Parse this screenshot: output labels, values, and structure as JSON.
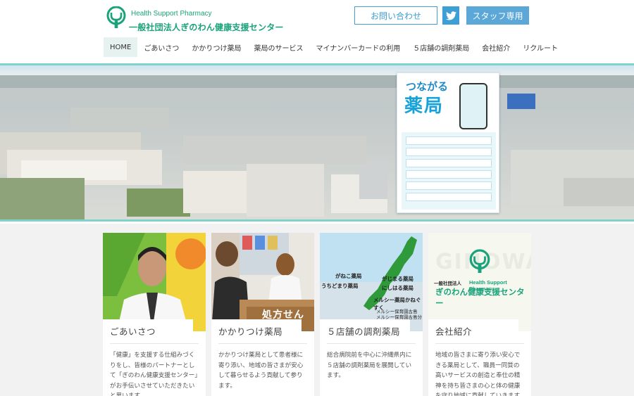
{
  "header": {
    "brand_en": "Health Support Pharmacy",
    "brand_jp": "一般社団法人ぎのわん健康支援センター",
    "contact_label": "お問い合わせ",
    "staff_label": "スタッフ専用",
    "twitter_icon": "twitter-bird-icon",
    "accent_color": "#1aa37a",
    "button_color": "#3d9fd6"
  },
  "nav": {
    "items": [
      "HOME",
      "ごあいさつ",
      "かかりつけ薬局",
      "薬局のサービス",
      "マイナンバーカードの利用",
      "５店舗の調剤薬局",
      "会社紹介",
      "リクルート"
    ],
    "active_index": 0
  },
  "hero": {
    "poster_title_small": "つながる",
    "poster_title_big": "薬局"
  },
  "cards": [
    {
      "title": "ごあいさつ",
      "text": "「健康」を支援する仕組みづくりをし、皆様のパートナーとして「ぎのわん健康支援センター」がお手伝いさせていただきたいと思います。"
    },
    {
      "title": "かかりつけ薬局",
      "text": "かかりつけ薬局として患者様に寄り添い、地域の皆さまが安心して暮らせるよう貢献して参ります。",
      "image_sign": "処方せん受"
    },
    {
      "title": "５店舗の調剤薬局",
      "text": "総合病院前を中心に沖縄県内に５店舗の調剤薬局を展開しています。",
      "map_labels": [
        "がねこ薬局",
        "がじまる薬局",
        "うちどまり薬局",
        "にしはる薬局",
        "メルシー薬局かねぐすく",
        "メルシー保育園古島",
        "メルシー保育園古島分園"
      ]
    },
    {
      "title": "会社紹介",
      "text": "地域の皆さまに寄り添い安心できる薬局として、職員一同質の高いサービスの創造と奉仕の精神を持ち皆さまの心と体の健康を守り地域に貢献していきます。",
      "logo_en": "Health Support Pharmacy",
      "logo_jp_small": "一般社団法人",
      "logo_jp": "ぎのわん健康支援センター",
      "bg_text": "GINOWAN"
    }
  ]
}
